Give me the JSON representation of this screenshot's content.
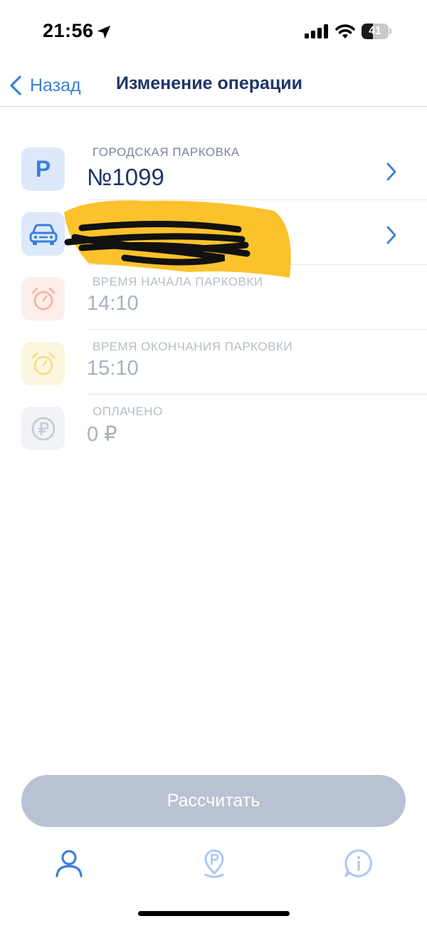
{
  "status_bar": {
    "time": "21:56",
    "battery_percent": 41,
    "battery_label": "41"
  },
  "nav": {
    "back_label": "Назад",
    "title": "Изменение операции"
  },
  "rows": [
    {
      "caption": "Городская парковка",
      "value": "№1099",
      "icon": "parking-p-icon",
      "enabled": true,
      "has_chevron": true
    },
    {
      "caption": "Транспортное средство",
      "value": "",
      "icon": "car-icon",
      "enabled": true,
      "has_chevron": true,
      "redacted": true
    },
    {
      "caption": "Время начала парковки",
      "value": "14:10",
      "icon": "alarm-clock-icon",
      "enabled": false
    },
    {
      "caption": "Время окончания парковки",
      "value": "15:10",
      "icon": "alarm-clock-icon",
      "enabled": false
    },
    {
      "caption": "Оплачено",
      "value": "0 ₽",
      "icon": "ruble-coin-icon",
      "enabled": false
    }
  ],
  "calculate_button": {
    "label": "Рассчитать",
    "enabled": false
  },
  "tabs": [
    {
      "icon": "profile-icon",
      "active": true
    },
    {
      "icon": "parking-pin-icon",
      "active": false
    },
    {
      "icon": "info-icon",
      "active": false
    }
  ],
  "colors": {
    "accent": "#3a7fdc",
    "title": "#1f3566",
    "caption": "#7a8699",
    "disabled_button": "#b9c2d2",
    "inactive_tab": "#a9c9f2",
    "redaction_highlight": "#fbc22b"
  }
}
